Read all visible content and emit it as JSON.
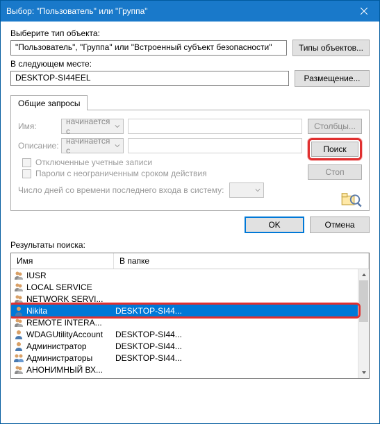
{
  "title": "Выбор: \"Пользователь\" или \"Группа\"",
  "labels": {
    "object_type": "Выберите тип объекта:",
    "object_type_value": "\"Пользователь\", \"Группа\" или \"Встроенный субъект безопасности\"",
    "btn_object_types": "Типы объектов...",
    "location": "В следующем месте:",
    "location_value": "DESKTOP-SI44EEL",
    "btn_locations": "Размещение...",
    "tab_common": "Общие запросы",
    "name": "Имя:",
    "description": "Описание:",
    "starts_with": "начинается с",
    "chk_disabled": "Отключенные учетные записи",
    "chk_nonexpire": "Пароли с неограниченным сроком действия",
    "days_label": "Число дней со времени последнего входа в систему:",
    "btn_columns": "Столбцы...",
    "btn_find": "Поиск",
    "btn_stop": "Стоп",
    "btn_ok": "OK",
    "btn_cancel": "Отмена",
    "results": "Результаты поиска:",
    "col_name": "Имя",
    "col_folder": "В папке"
  },
  "rows": [
    {
      "icon": "user",
      "name": "IUSR",
      "folder": ""
    },
    {
      "icon": "user",
      "name": "LOCAL SERVICE",
      "folder": ""
    },
    {
      "icon": "user",
      "name": "NETWORK SERVI...",
      "folder": ""
    },
    {
      "icon": "person",
      "name": "Nikita",
      "folder": "DESKTOP-SI44...",
      "sel": true,
      "hl": true
    },
    {
      "icon": "user",
      "name": "REMOTE INTERA...",
      "folder": ""
    },
    {
      "icon": "person",
      "name": "WDAGUtilityAccount",
      "folder": "DESKTOP-SI44..."
    },
    {
      "icon": "person",
      "name": "Администратор",
      "folder": "DESKTOP-SI44..."
    },
    {
      "icon": "group",
      "name": "Администраторы",
      "folder": "DESKTOP-SI44..."
    },
    {
      "icon": "user",
      "name": "АНОНИМНЫЙ ВХ...",
      "folder": ""
    }
  ]
}
